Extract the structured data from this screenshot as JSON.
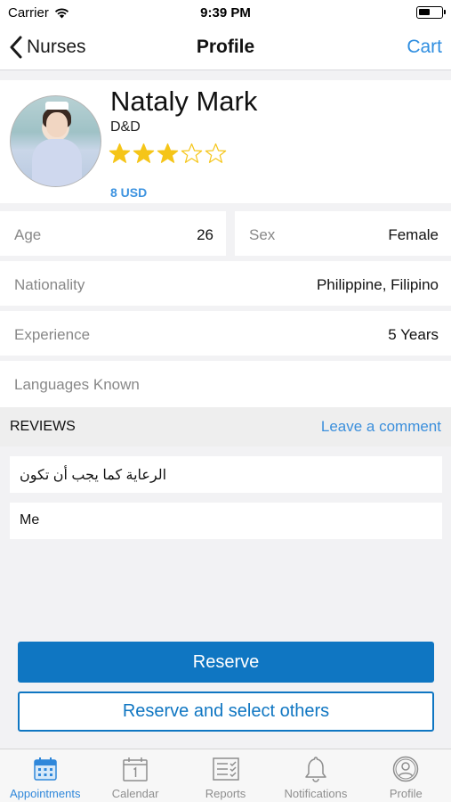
{
  "status_bar": {
    "carrier": "Carrier",
    "time": "9:39 PM"
  },
  "nav": {
    "back_label": "Nurses",
    "title": "Profile",
    "cart_label": "Cart"
  },
  "profile": {
    "name": "Nataly Mark",
    "company": "D&D",
    "rating": 3,
    "rating_max": 5,
    "price": "8 USD"
  },
  "details": {
    "age_label": "Age",
    "age_value": "26",
    "sex_label": "Sex",
    "sex_value": "Female",
    "nationality_label": "Nationality",
    "nationality_value": "Philippine, Filipino",
    "experience_label": "Experience",
    "experience_value": "5 Years",
    "languages_label": "Languages Known"
  },
  "reviews": {
    "title": "REVIEWS",
    "leave_comment": "Leave a comment",
    "items": [
      "الرعاية كما يجب أن تكون",
      "Me"
    ]
  },
  "actions": {
    "reserve": "Reserve",
    "reserve_others": "Reserve and select others"
  },
  "tabs": [
    {
      "label": "Appointments",
      "icon": "appointments-icon",
      "active": true
    },
    {
      "label": "Calendar",
      "icon": "calendar-icon",
      "active": false
    },
    {
      "label": "Reports",
      "icon": "reports-icon",
      "active": false
    },
    {
      "label": "Notifications",
      "icon": "bell-icon",
      "active": false
    },
    {
      "label": "Profile",
      "icon": "profile-icon",
      "active": false
    }
  ],
  "colors": {
    "accent": "#0f76c2",
    "link": "#3b8fdc",
    "star": "#f5c518",
    "tab_active": "#2f87da"
  }
}
